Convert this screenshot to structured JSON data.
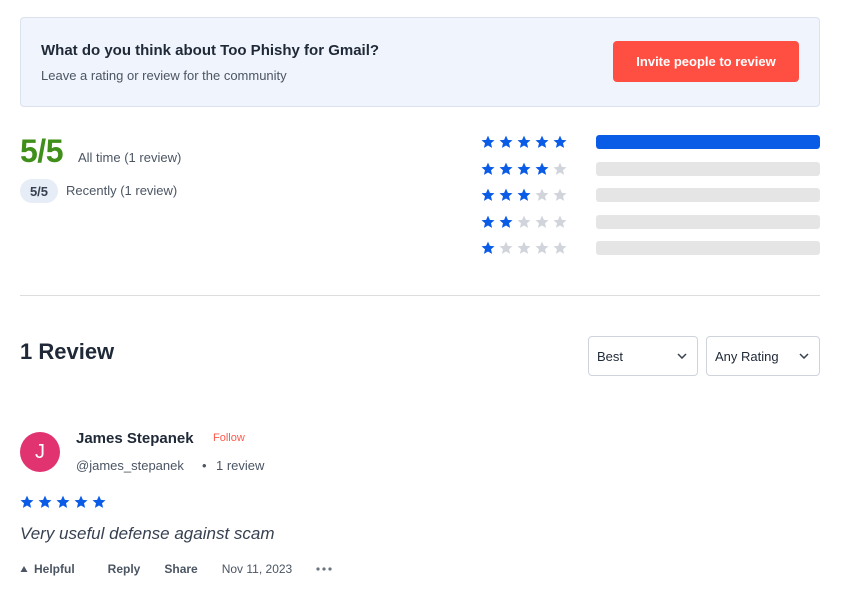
{
  "colors": {
    "accent_star": "#0a5be6",
    "empty_star": "#d1d5db",
    "brand_button": "#ff4f42",
    "score_green": "#3f8f1a",
    "avatar": "#e0336f"
  },
  "banner": {
    "title": "What do you think about Too Phishy for Gmail?",
    "subtitle": "Leave a rating or review for the community",
    "invite_label": "Invite people to review"
  },
  "summary": {
    "score": "5/5",
    "all_time": "All time (1 review)",
    "recent_score": "5/5",
    "recently": "Recently (1 review)"
  },
  "distribution": [
    {
      "stars": 5,
      "fraction": 1.0
    },
    {
      "stars": 4,
      "fraction": 0.0
    },
    {
      "stars": 3,
      "fraction": 0.0
    },
    {
      "stars": 2,
      "fraction": 0.0
    },
    {
      "stars": 1,
      "fraction": 0.0
    }
  ],
  "reviews_section": {
    "heading": "1 Review",
    "sort_value": "Best",
    "rating_filter_value": "Any Rating"
  },
  "review": {
    "avatar_letter": "J",
    "name": "James Stepanek",
    "follow_label": "Follow",
    "handle": "@james_stepanek",
    "separator": "•",
    "review_count": "1 review",
    "rating": 5,
    "text": "Very useful defense against scam",
    "helpful_label": "Helpful",
    "reply_label": "Reply",
    "share_label": "Share",
    "date": "Nov 11, 2023",
    "more_icon": "ellipsis-icon"
  }
}
